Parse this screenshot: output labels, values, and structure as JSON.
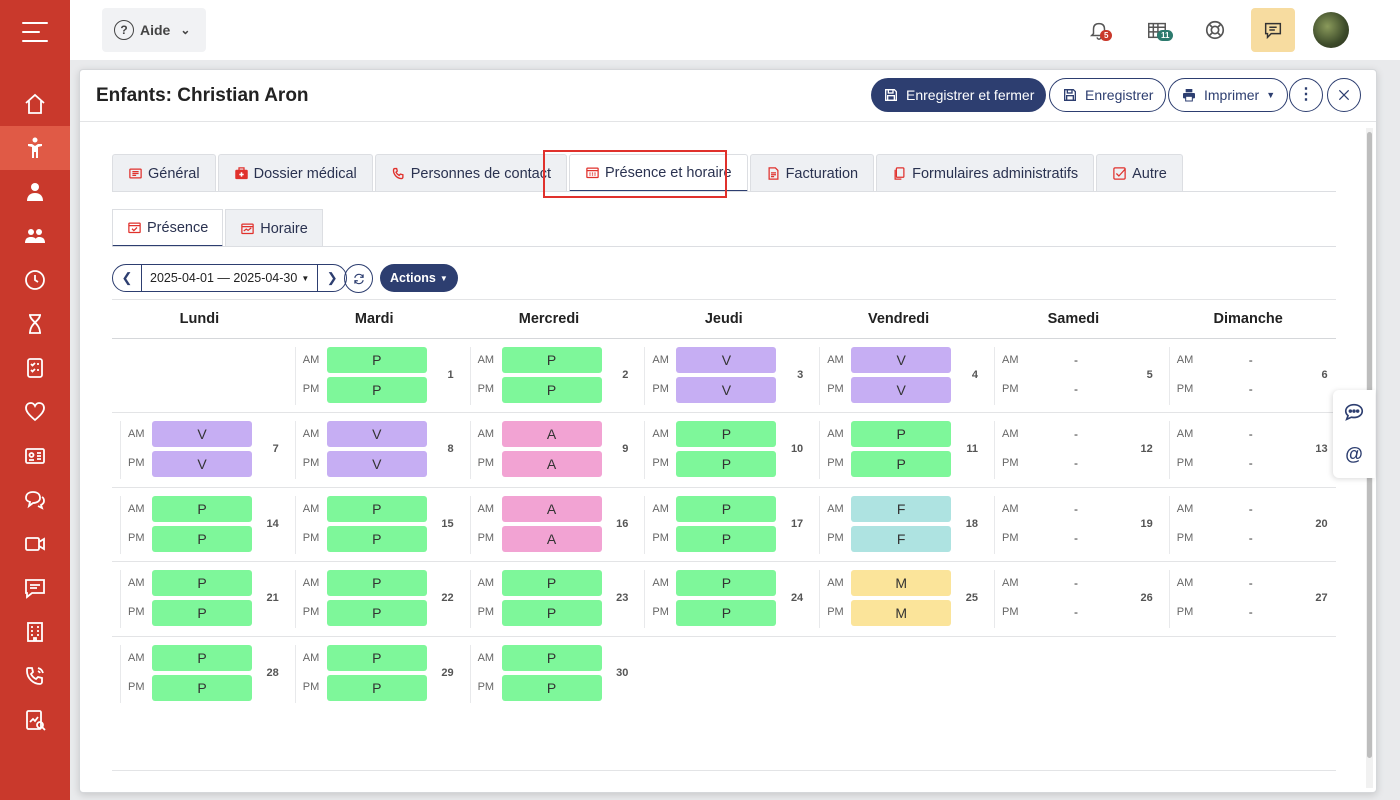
{
  "topbar": {
    "help_label": "Aide",
    "notifications_badge": "5",
    "messages_badge": "11"
  },
  "dialog": {
    "title": "Enfants: Christian Aron",
    "save_close_label": "Enregistrer et fermer",
    "save_label": "Enregistrer",
    "print_label": "Imprimer"
  },
  "tabs": [
    {
      "label": "Général",
      "icon": "list-icon"
    },
    {
      "label": "Dossier médical",
      "icon": "medical-kit-icon"
    },
    {
      "label": "Personnes de contact",
      "icon": "phone-icon"
    },
    {
      "label": "Présence et horaire",
      "icon": "calendar-icon"
    },
    {
      "label": "Facturation",
      "icon": "invoice-icon"
    },
    {
      "label": "Formulaires administratifs",
      "icon": "copy-icon"
    },
    {
      "label": "Autre",
      "icon": "checkbox-icon"
    }
  ],
  "subtabs": [
    {
      "label": "Présence",
      "icon": "calendar-check-icon"
    },
    {
      "label": "Horaire",
      "icon": "calendar-chart-icon"
    }
  ],
  "toolbar": {
    "date_range": "2025-04-01 — 2025-04-30",
    "actions_label": "Actions"
  },
  "calendar": {
    "am_label": "AM",
    "pm_label": "PM",
    "days": [
      "Lundi",
      "Mardi",
      "Mercredi",
      "Jeudi",
      "Vendredi",
      "Samedi",
      "Dimanche"
    ],
    "status_colors": {
      "P": "#7ef79a",
      "V": "#c6aef3",
      "A": "#f2a3d3",
      "F": "#aee3e1",
      "M": "#fbe49a"
    },
    "weeks": [
      [
        null,
        {
          "d": "1",
          "am": "P",
          "pm": "P"
        },
        {
          "d": "2",
          "am": "P",
          "pm": "P"
        },
        {
          "d": "3",
          "am": "V",
          "pm": "V"
        },
        {
          "d": "4",
          "am": "V",
          "pm": "V"
        },
        {
          "d": "5",
          "am": "-",
          "pm": "-"
        },
        {
          "d": "6",
          "am": "-",
          "pm": "-"
        }
      ],
      [
        {
          "d": "7",
          "am": "V",
          "pm": "V"
        },
        {
          "d": "8",
          "am": "V",
          "pm": "V"
        },
        {
          "d": "9",
          "am": "A",
          "pm": "A"
        },
        {
          "d": "10",
          "am": "P",
          "pm": "P"
        },
        {
          "d": "11",
          "am": "P",
          "pm": "P"
        },
        {
          "d": "12",
          "am": "-",
          "pm": "-"
        },
        {
          "d": "13",
          "am": "-",
          "pm": "-"
        }
      ],
      [
        {
          "d": "14",
          "am": "P",
          "pm": "P"
        },
        {
          "d": "15",
          "am": "P",
          "pm": "P"
        },
        {
          "d": "16",
          "am": "A",
          "pm": "A"
        },
        {
          "d": "17",
          "am": "P",
          "pm": "P"
        },
        {
          "d": "18",
          "am": "F",
          "pm": "F"
        },
        {
          "d": "19",
          "am": "-",
          "pm": "-"
        },
        {
          "d": "20",
          "am": "-",
          "pm": "-"
        }
      ],
      [
        {
          "d": "21",
          "am": "P",
          "pm": "P"
        },
        {
          "d": "22",
          "am": "P",
          "pm": "P"
        },
        {
          "d": "23",
          "am": "P",
          "pm": "P"
        },
        {
          "d": "24",
          "am": "P",
          "pm": "P"
        },
        {
          "d": "25",
          "am": "M",
          "pm": "M"
        },
        {
          "d": "26",
          "am": "-",
          "pm": "-"
        },
        {
          "d": "27",
          "am": "-",
          "pm": "-"
        }
      ],
      [
        {
          "d": "28",
          "am": "P",
          "pm": "P"
        },
        {
          "d": "29",
          "am": "P",
          "pm": "P"
        },
        {
          "d": "30",
          "am": "P",
          "pm": "P"
        },
        null,
        null,
        null,
        null
      ]
    ]
  },
  "sidebar": {
    "items": [
      "home-icon",
      "child-icon",
      "user-icon",
      "group-icon",
      "clock-icon",
      "hourglass-icon",
      "checklist-icon",
      "heart-icon",
      "id-card-icon",
      "chat-bubbles-icon",
      "video-icon",
      "message-icon",
      "building-icon",
      "phone-icon",
      "report-icon"
    ]
  },
  "colors": {
    "sidebar": "#c9392c",
    "sidebar_active": "#e05a46",
    "primary": "#2d3e70",
    "highlight": "#e0312c"
  }
}
